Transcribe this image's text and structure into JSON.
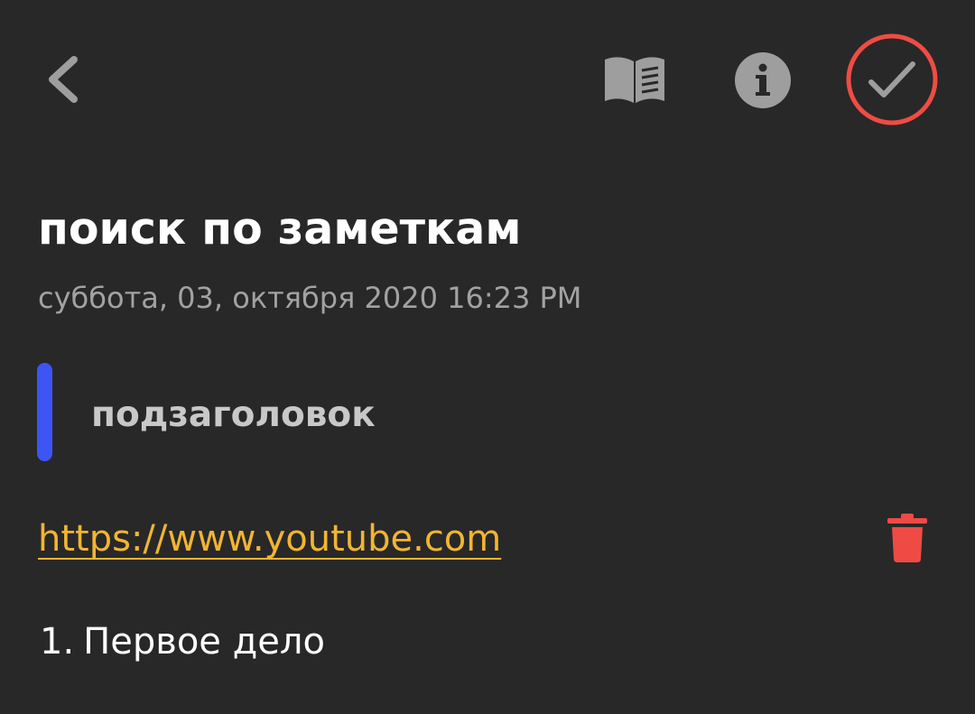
{
  "toolbar": {
    "icons": [
      "back-arrow-icon",
      "reader-mode-icon",
      "info-icon",
      "checkmark-icon"
    ]
  },
  "note": {
    "title": "поиск по заметкам",
    "date": "суббота, 03, октября 2020 16:23 PM",
    "subtitle": "подзаголовок",
    "link": "https://www.youtube.com",
    "list": [
      {
        "number": "1.",
        "text": "Первое дело"
      }
    ]
  },
  "colors": {
    "background": "#282828",
    "icon_gray": "#9e9e9e",
    "accent_blue": "#3d55f5",
    "link_yellow": "#f2b531",
    "delete_red": "#f04a44",
    "done_ring_red": "#ef4c44"
  }
}
